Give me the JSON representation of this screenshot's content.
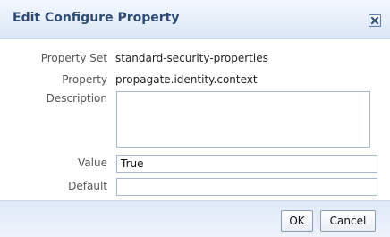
{
  "dialog": {
    "title": "Edit Configure Property",
    "close_icon": "close-icon"
  },
  "fields": {
    "property_set": {
      "label": "Property Set",
      "value": "standard-security-properties"
    },
    "property": {
      "label": "Property",
      "value": "propagate.identity.context"
    },
    "description": {
      "label": "Description",
      "value": ""
    },
    "value": {
      "label": "Value",
      "value": "True"
    },
    "default": {
      "label": "Default",
      "value": ""
    }
  },
  "buttons": {
    "ok_label": "OK",
    "cancel_label": "Cancel"
  },
  "colors": {
    "title_text": "#2c4a72",
    "header_bg": "#e6eefa",
    "footer_bg": "#e6eefa"
  }
}
